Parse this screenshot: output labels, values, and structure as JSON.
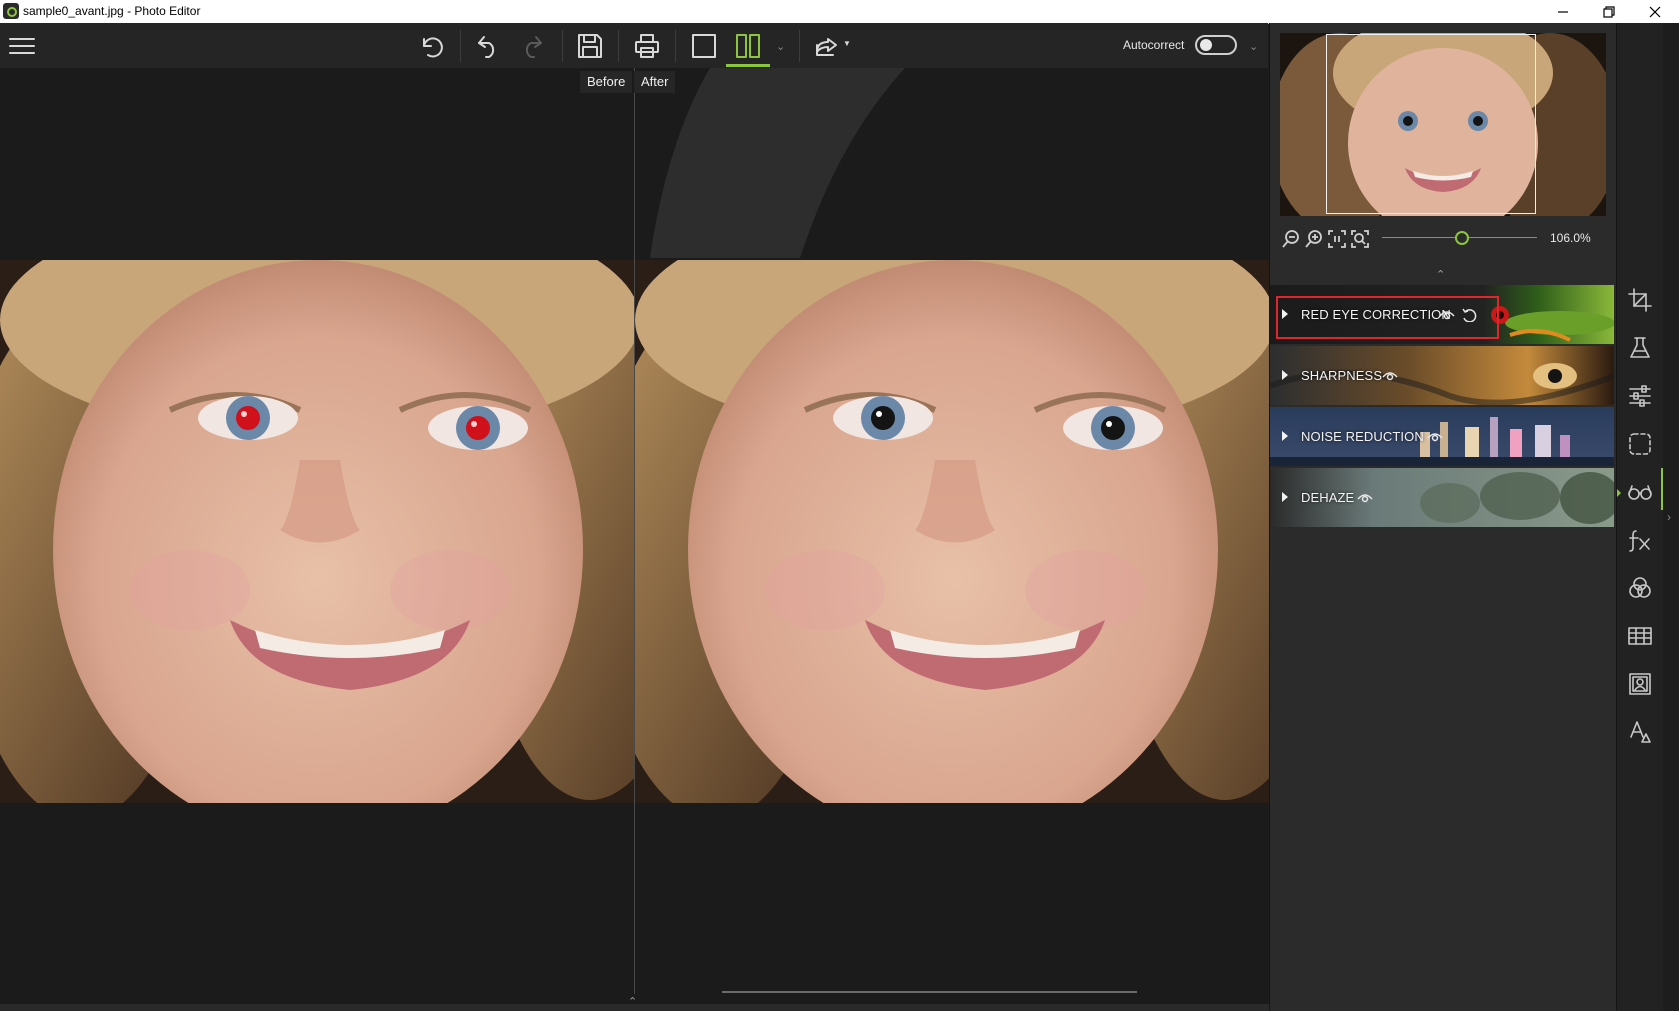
{
  "window": {
    "title": "sample0_avant.jpg - Photo Editor",
    "controls": {
      "minimize": "minimize-icon",
      "restore": "restore-icon",
      "close": "close-icon"
    }
  },
  "toolbar": {
    "menu_icon": "hamburger-icon",
    "undo_all_icon": "undo-all-icon",
    "undo_icon": "undo-icon",
    "redo_icon": "redo-icon",
    "save_icon": "save-icon",
    "print_icon": "print-icon",
    "single_view_icon": "single-view-icon",
    "split_view_icon": "split-view-icon",
    "share_icon": "share-icon",
    "autocorrect_label": "Autocorrect",
    "autocorrect_on": false
  },
  "compare": {
    "before_label": "Before",
    "after_label": "After"
  },
  "navigator": {
    "zoom_value": "106.0%",
    "zoom_fraction": 0.5,
    "zoom_out_icon": "zoom-out-icon",
    "zoom_in_icon": "zoom-in-icon",
    "actual_size_icon": "actual-size-icon",
    "fit_icon": "fit-to-screen-icon"
  },
  "effects": [
    {
      "label": "RED EYE CORRECTION",
      "highlighted": true,
      "has_reset": true
    },
    {
      "label": "SHARPNESS",
      "highlighted": false,
      "has_reset": false
    },
    {
      "label": "NOISE REDUCTION",
      "highlighted": false,
      "has_reset": false
    },
    {
      "label": "DEHAZE",
      "highlighted": false,
      "has_reset": false
    }
  ],
  "side_tools": [
    "crop-icon",
    "lab-flask-icon",
    "adjust-sliders-icon",
    "selection-icon",
    "glasses-icon",
    "fx-icon",
    "color-circles-icon",
    "frame-grid-icon",
    "portrait-icon",
    "text-icon"
  ],
  "colors": {
    "accent": "#8cc63f",
    "highlight": "#e0262c",
    "panel": "#2b2b2b",
    "canvas": "#1b1b1b"
  }
}
